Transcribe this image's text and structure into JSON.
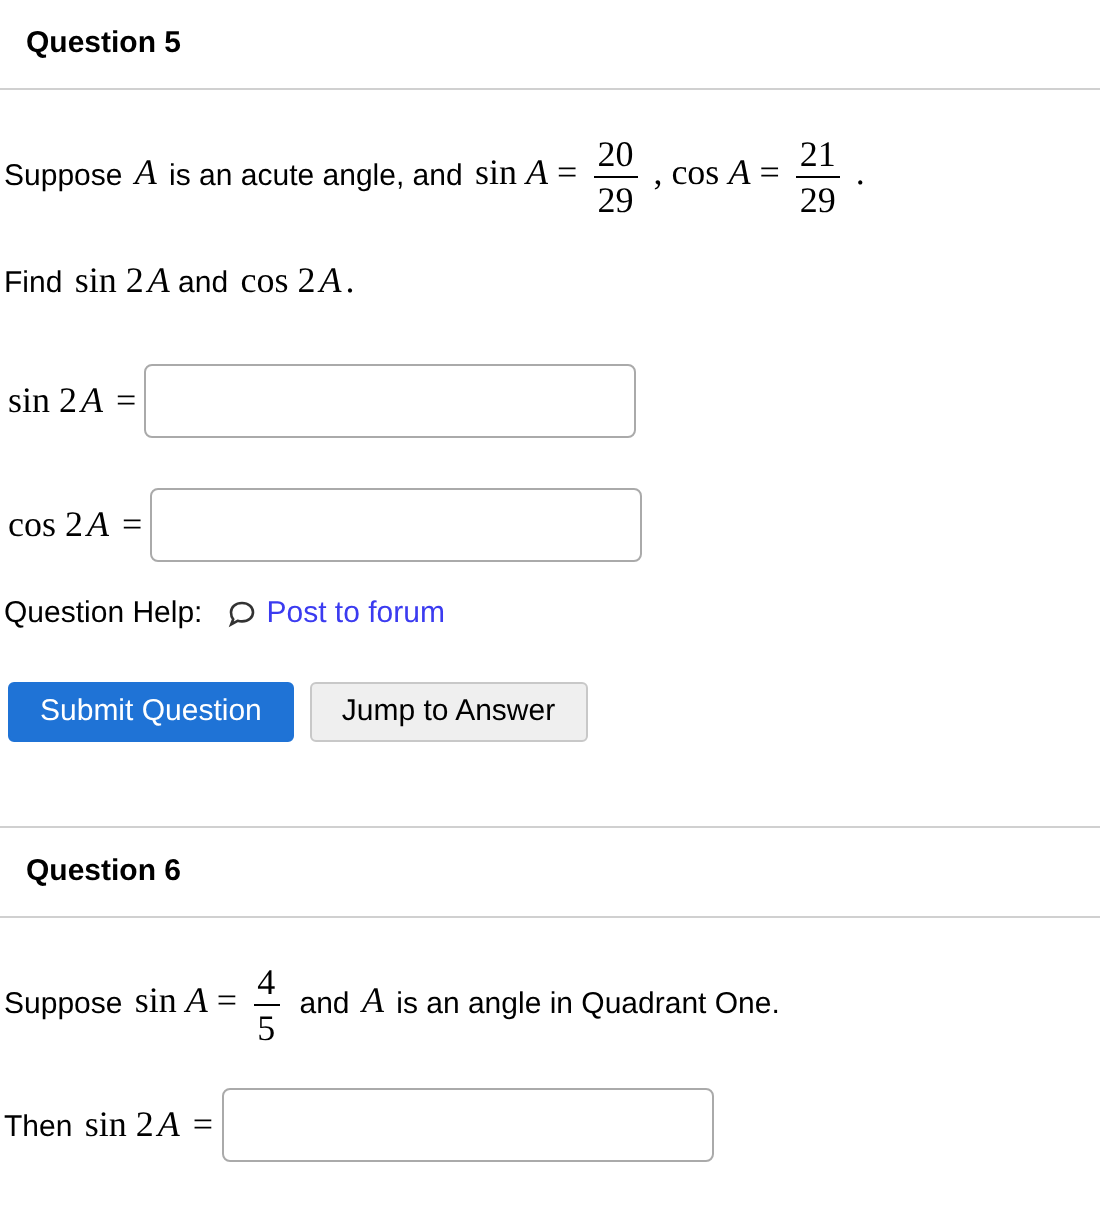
{
  "questions": [
    {
      "title": "Question 5",
      "prompt": [
        [
          {
            "kind": "text",
            "text": "Suppose "
          },
          {
            "kind": "math",
            "text": "*A*"
          },
          {
            "kind": "text",
            "text": " is an acute angle, and "
          },
          {
            "kind": "math",
            "text": "sin *A* ="
          },
          {
            "kind": "frac",
            "num": "20",
            "den": "29"
          },
          {
            "kind": "math",
            "text": ", cos *A* ="
          },
          {
            "kind": "frac",
            "num": "21",
            "den": "29"
          },
          {
            "kind": "math",
            "text": "."
          }
        ],
        [
          {
            "kind": "text",
            "text": "Find "
          },
          {
            "kind": "math",
            "text": "sin 2"
          },
          {
            "kind": "var",
            "text": "A"
          },
          {
            "kind": "text",
            "text": " and "
          },
          {
            "kind": "math",
            "text": "cos 2"
          },
          {
            "kind": "var",
            "text": "A"
          },
          {
            "kind": "math",
            "text": "."
          }
        ]
      ],
      "answers": [
        {
          "label": [
            {
              "kind": "math",
              "text": "sin 2"
            },
            {
              "kind": "var",
              "text": "A"
            },
            {
              "kind": "math",
              "text": " ="
            }
          ]
        },
        {
          "label": [
            {
              "kind": "math",
              "text": "cos 2"
            },
            {
              "kind": "var",
              "text": "A"
            },
            {
              "kind": "math",
              "text": " ="
            }
          ]
        }
      ],
      "help": {
        "label": "Question Help:",
        "link": "Post to forum"
      },
      "buttons": [
        {
          "label": "Submit Question",
          "kind": "primary"
        },
        {
          "label": "Jump to Answer",
          "kind": "secondary"
        }
      ]
    },
    {
      "title": "Question 6",
      "prompt": [
        [
          {
            "kind": "text",
            "text": "Suppose "
          },
          {
            "kind": "math",
            "text": "sin *A* ="
          },
          {
            "kind": "frac",
            "num": "4",
            "den": "5"
          },
          {
            "kind": "text",
            "text": " and "
          },
          {
            "kind": "math",
            "text": "*A*"
          },
          {
            "kind": "text",
            "text": " is an angle in Quadrant One."
          }
        ]
      ],
      "answers": [
        {
          "label": [
            {
              "kind": "text",
              "text": "Then "
            },
            {
              "kind": "math",
              "text": "sin 2"
            },
            {
              "kind": "var",
              "text": "A"
            },
            {
              "kind": "math",
              "text": " ="
            }
          ]
        }
      ]
    }
  ]
}
